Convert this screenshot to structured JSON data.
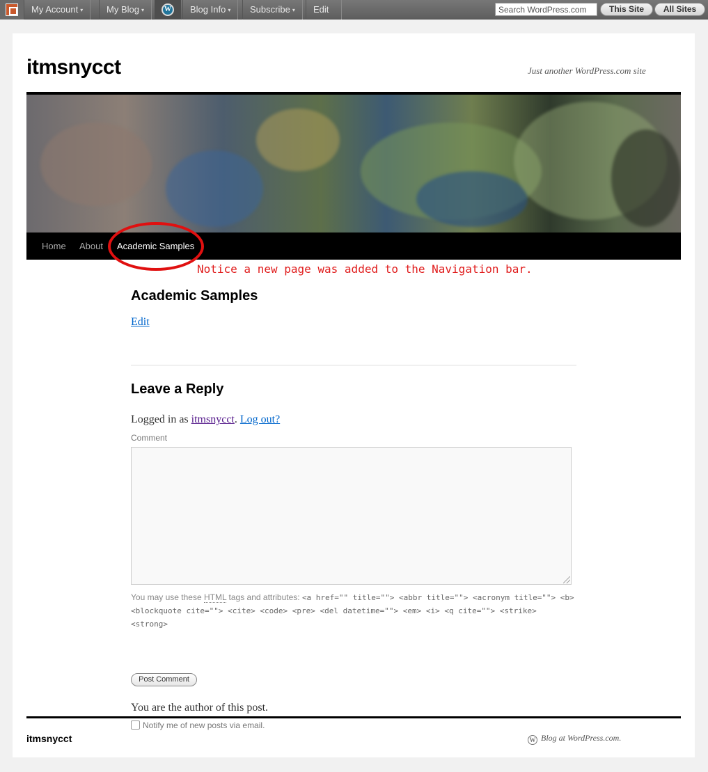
{
  "adminbar": {
    "logo_icon": "wordpress-blavatar-icon",
    "my_account": "My Account",
    "my_blog": "My Blog",
    "wp_icon": "wordpress-logo-icon",
    "wp_icon_glyph": "W",
    "blog_info": "Blog Info",
    "subscribe": "Subscribe",
    "edit": "Edit",
    "caret": "▾",
    "search_value": "Search WordPress.com",
    "this_site": "This Site",
    "all_sites": "All Sites"
  },
  "site": {
    "title": "itmsnycct",
    "description": "Just another WordPress.com site"
  },
  "nav": {
    "items": [
      {
        "label": "Home"
      },
      {
        "label": "About"
      },
      {
        "label": "Academic Samples"
      }
    ],
    "active": "Academic Samples"
  },
  "annotation": "Notice a new page was added to the Navigation bar.",
  "entry": {
    "title": "Academic Samples",
    "edit_link": "Edit"
  },
  "reply": {
    "title": "Leave a Reply",
    "logged_in_prefix": "Logged in as ",
    "username": "itmsnycct",
    "separator": ". ",
    "logout": "Log out?",
    "comment_label": "Comment",
    "allowed_prefix": "You may use these ",
    "allowed_abbr": "HTML",
    "allowed_middle": " tags and attributes: ",
    "allowed_tags": "<a href=\"\" title=\"\"> <abbr title=\"\"> <acronym title=\"\"> <b> <blockquote cite=\"\"> <cite> <code> <pre> <del datetime=\"\"> <em> <i> <q cite=\"\"> <strike> <strong>",
    "post_button": "Post Comment",
    "author_note": "You are the author of this post.",
    "notify_label": "Notify me of new posts via email."
  },
  "footer": {
    "title": "itmsnycct",
    "credit": "Blog at WordPress.com.",
    "credit_icon": "wordpress-logo-icon",
    "credit_icon_glyph": "W"
  },
  "colors": {
    "annotation_red": "#e01b1b",
    "link_blue": "#0066cc",
    "visited_purple": "#551a8b"
  }
}
